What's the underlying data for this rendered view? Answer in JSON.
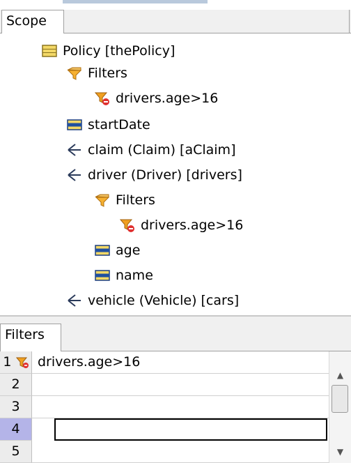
{
  "scope": {
    "tab_label": "Scope",
    "tree": [
      {
        "label": "Policy [thePolicy]",
        "icon": "entity-icon"
      },
      {
        "label": "Filters",
        "icon": "filter-folder-icon"
      },
      {
        "label": "drivers.age>16",
        "icon": "filter-error-icon"
      },
      {
        "label": "startDate",
        "icon": "attribute-icon"
      },
      {
        "label": "claim (Claim) [aClaim]",
        "icon": "relation-icon"
      },
      {
        "label": "driver (Driver) [drivers]",
        "icon": "relation-icon"
      },
      {
        "label": "Filters",
        "icon": "filter-folder-icon"
      },
      {
        "label": "drivers.age>16",
        "icon": "filter-error-icon"
      },
      {
        "label": "age",
        "icon": "attribute-icon"
      },
      {
        "label": "name",
        "icon": "attribute-icon"
      },
      {
        "label": "vehicle (Vehicle) [cars]",
        "icon": "relation-icon"
      }
    ]
  },
  "filters": {
    "tab_label": "Filters",
    "rows": [
      {
        "num": "1",
        "value": "drivers.age>16",
        "error": true
      },
      {
        "num": "2",
        "value": ""
      },
      {
        "num": "3",
        "value": ""
      },
      {
        "num": "4",
        "value": "",
        "selected": true
      },
      {
        "num": "5",
        "value": ""
      }
    ]
  },
  "colors": {
    "entity": "#e0c040",
    "attribute": "#2050a0",
    "filter": "#e09020",
    "error": "#e03030",
    "selected_row": "#b4b4e8"
  }
}
